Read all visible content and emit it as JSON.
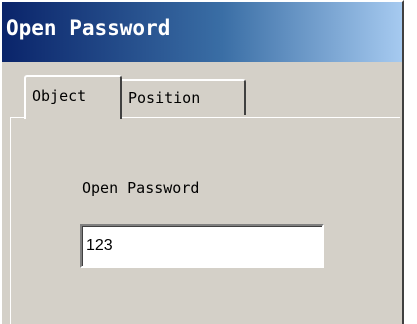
{
  "window": {
    "title": "Open Password"
  },
  "tabs": [
    {
      "label": "Object",
      "active": true
    },
    {
      "label": "Position",
      "active": false
    }
  ],
  "form": {
    "password_label": "Open Password",
    "password_value": "123"
  },
  "colors": {
    "titlebar_start": "#0a246a",
    "titlebar_end": "#a6caf0",
    "face": "#d4d0c8"
  }
}
